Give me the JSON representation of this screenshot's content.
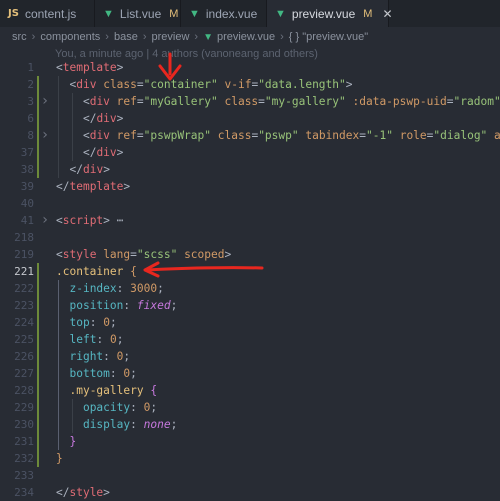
{
  "tabs": [
    {
      "icon": "JS",
      "name": "content.js",
      "modified": "",
      "active": false
    },
    {
      "icon": "V",
      "name": "List.vue",
      "modified": "M",
      "active": false
    },
    {
      "icon": "V",
      "name": "index.vue",
      "modified": "",
      "active": false
    },
    {
      "icon": "V",
      "name": "preview.vue",
      "modified": "M",
      "active": true
    }
  ],
  "breadcrumb": {
    "items": [
      "src",
      "components",
      "base",
      "preview",
      "preview.vue",
      "{ } \"preview.vue\""
    ]
  },
  "codelens": "You, a minute ago | 4 authors (vanoneang and others)",
  "code": {
    "lines": [
      {
        "n": "1",
        "raw": "<template>"
      },
      {
        "n": "2",
        "raw": "  <div class=\"container\" v-if=\"data.length\">"
      },
      {
        "n": "3",
        "raw": "    <div ref=\"myGallery\" class=\"my-gallery\" :data-pswp-uid=\"radom\">"
      },
      {
        "n": "6",
        "raw": "    </div>"
      },
      {
        "n": "8",
        "raw": "    <div ref=\"pswpWrap\" class=\"pswp\" tabindex=\"-1\" role=\"dialog\" ar"
      },
      {
        "n": "37",
        "raw": "    </div>"
      },
      {
        "n": "38",
        "raw": "  </div>"
      },
      {
        "n": "39",
        "raw": "</template>"
      },
      {
        "n": "40",
        "raw": ""
      },
      {
        "n": "41",
        "raw": "<script> ⋯"
      },
      {
        "n": "218",
        "raw": ""
      },
      {
        "n": "219",
        "raw": "<style lang=\"scss\" scoped>"
      },
      {
        "n": "221",
        "raw": ".container {"
      },
      {
        "n": "222",
        "raw": "  z-index: 3000;"
      },
      {
        "n": "223",
        "raw": "  position: fixed;"
      },
      {
        "n": "224",
        "raw": "  top: 0;"
      },
      {
        "n": "225",
        "raw": "  left: 0;"
      },
      {
        "n": "226",
        "raw": "  right: 0;"
      },
      {
        "n": "227",
        "raw": "  bottom: 0;"
      },
      {
        "n": "228",
        "raw": "  .my-gallery {"
      },
      {
        "n": "229",
        "raw": "    opacity: 0;"
      },
      {
        "n": "230",
        "raw": "    display: none;"
      },
      {
        "n": "231",
        "raw": "  }"
      },
      {
        "n": "232",
        "raw": "}"
      },
      {
        "n": "233",
        "raw": ""
      },
      {
        "n": "234",
        "raw": "</style>"
      }
    ]
  },
  "colors": {
    "editor_bg": "#282c34",
    "tab_bg": "#21252b",
    "tag": "#e06c75",
    "attribute": "#d19a66",
    "string": "#98c379",
    "selector": "#e5c07b",
    "property": "#56b6c2",
    "keyword": "#c678dd",
    "annotation_arrow": "#e8271f"
  }
}
